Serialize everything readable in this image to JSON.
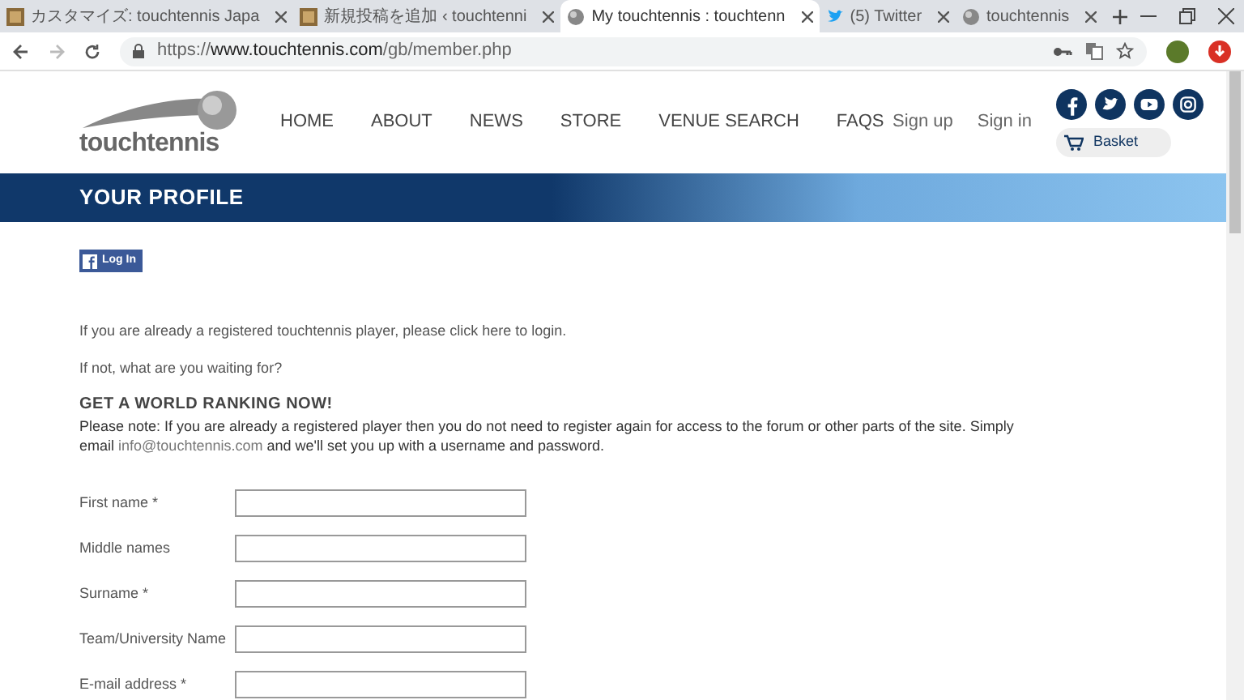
{
  "browser": {
    "tabs": [
      {
        "title": "カスタマイズ: touchtennis Japa",
        "kind": "thumbnail",
        "selected": false
      },
      {
        "title": "新規投稿を追加 ‹ touchtenni",
        "kind": "thumbnail",
        "selected": false
      },
      {
        "title": "My touchtennis : touchtenn",
        "kind": "ball",
        "selected": true
      },
      {
        "title": "(5) Twitter",
        "kind": "bird",
        "selected": false
      },
      {
        "title": "touchtennis",
        "kind": "ball",
        "selected": false
      }
    ],
    "url_prefix": "https://",
    "url_host": "www.touchtennis.com",
    "url_path": "/gb/member.php"
  },
  "header": {
    "logo": "touchtennis",
    "nav": [
      "HOME",
      "ABOUT",
      "NEWS",
      "STORE",
      "VENUE SEARCH",
      "FAQS"
    ],
    "account_links": [
      "Sign up",
      "Sign in"
    ],
    "social": [
      {
        "kind": "facebook"
      },
      {
        "kind": "twitter"
      },
      {
        "kind": "youtube"
      },
      {
        "kind": "instagram"
      }
    ],
    "basket": "Basket"
  },
  "banner": {
    "title": "YOUR PROFILE"
  },
  "content": {
    "facebook_login": "Log In",
    "intro": "If you are already a registered touchtennis player, please click here to login.",
    "question": "If not, what are you waiting for?",
    "heading": "GET A WORLD RANKING NOW!",
    "note": "Please note: If you are already a registered player then you do not need to register again for access to the forum or other parts of the site. Simply email",
    "email_link": "info@touchtennis.com",
    "note_end": " and we'll set you up with a username and password.",
    "fields": [
      {
        "label": "First name *"
      },
      {
        "label": "Middle names"
      },
      {
        "label": "Surname *"
      },
      {
        "label": "Team/University Name"
      },
      {
        "label": "E-mail address *"
      }
    ]
  }
}
